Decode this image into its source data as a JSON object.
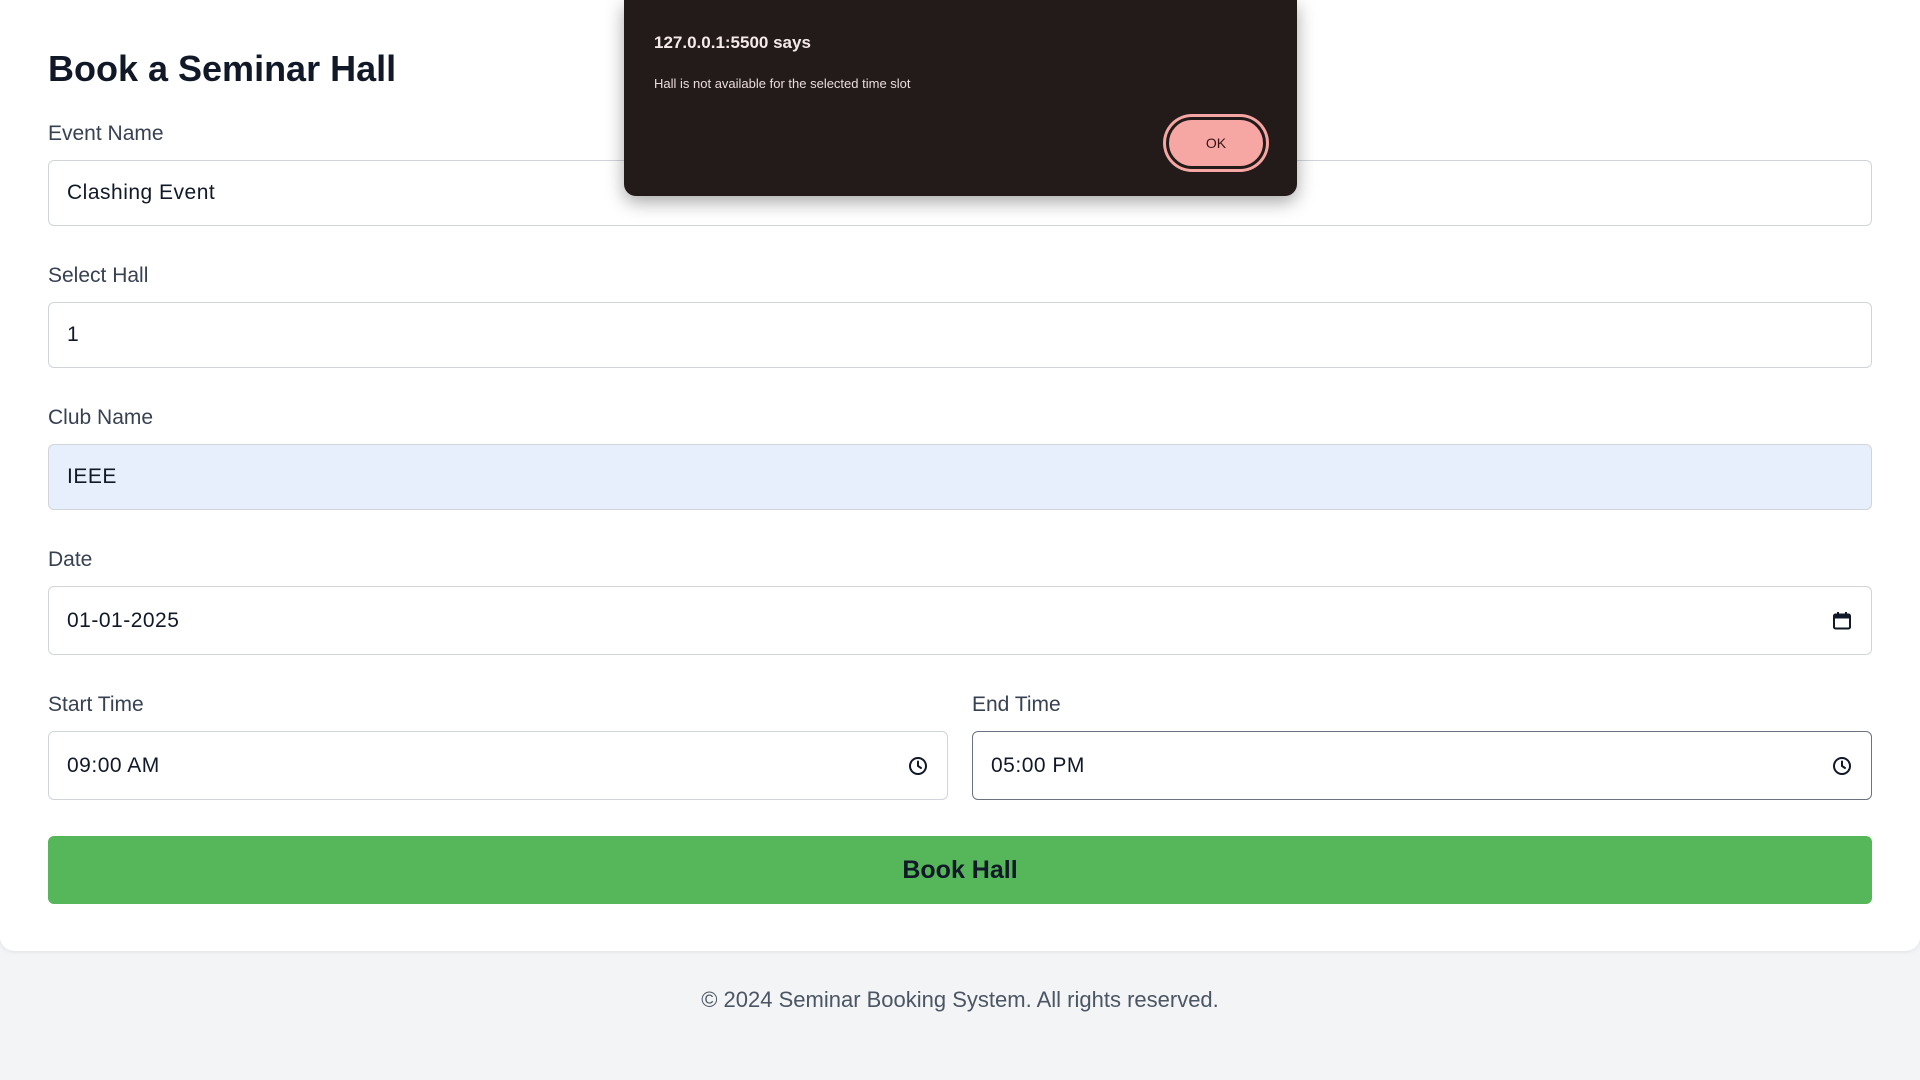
{
  "form": {
    "title": "Book a Seminar Hall",
    "event_name": {
      "label": "Event Name",
      "value": "Clashing Event"
    },
    "hall": {
      "label": "Select Hall",
      "value": "1"
    },
    "club_name": {
      "label": "Club Name",
      "value": "IEEE"
    },
    "date": {
      "label": "Date",
      "value": "01-01-2025",
      "icon": "calendar-icon"
    },
    "start_time": {
      "label": "Start Time",
      "value": "09:00 AM",
      "icon": "clock-icon"
    },
    "end_time": {
      "label": "End Time",
      "value": "05:00 PM",
      "icon": "clock-icon"
    },
    "submit_label": "Book Hall"
  },
  "footer": {
    "text": "© 2024 Seminar Booking System. All rights reserved."
  },
  "alert": {
    "origin": "127.0.0.1:5500 says",
    "message": "Hall is not available for the selected time slot",
    "ok_label": "OK"
  },
  "colors": {
    "button_green": "#55b65a",
    "autofill_blue": "#e8effc",
    "dialog_bg": "#231a1a",
    "dialog_button": "#f6a6a3"
  }
}
